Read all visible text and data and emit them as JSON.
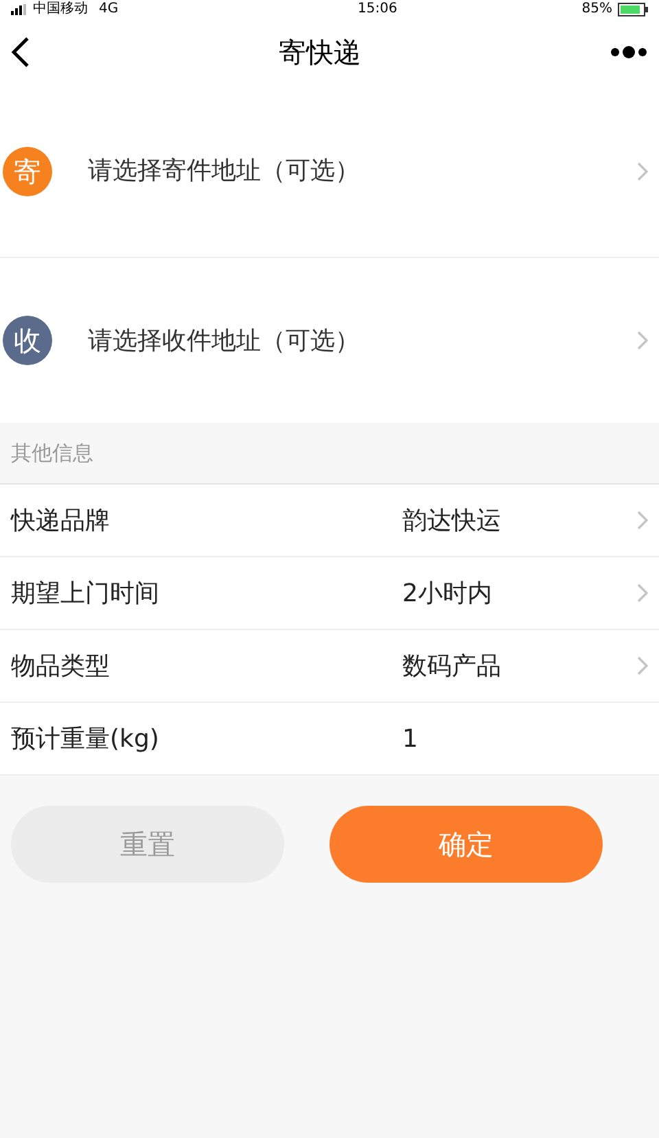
{
  "status_bar": {
    "carrier": "中国移动",
    "network": "4G",
    "time": "15:06",
    "battery": "85%"
  },
  "nav": {
    "title": "寄快递"
  },
  "addresses": [
    {
      "badge": "寄",
      "color": "#f5821f",
      "placeholder": "请选择寄件地址（可选）"
    },
    {
      "badge": "收",
      "color": "#5a6b8c",
      "placeholder": "请选择收件地址（可选）"
    }
  ],
  "section": {
    "title": "其他信息"
  },
  "fields": [
    {
      "kind": "select",
      "label": "快递品牌",
      "value": "韵达快运"
    },
    {
      "kind": "select",
      "label": "期望上门时间",
      "value": "2小时内"
    },
    {
      "kind": "select",
      "label": "物品类型",
      "value": "数码产品"
    },
    {
      "kind": "input",
      "label": "预计重量(kg)",
      "value": "1"
    }
  ],
  "buttons": [
    {
      "kind": "secondary",
      "label": "重置"
    },
    {
      "kind": "primary",
      "label": "确定"
    }
  ]
}
